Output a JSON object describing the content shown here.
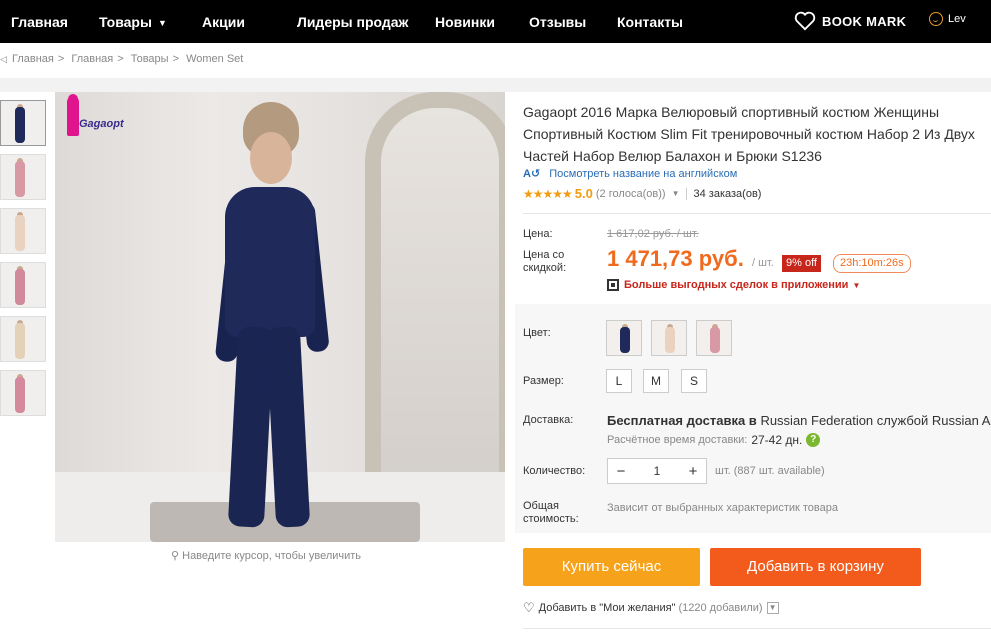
{
  "nav": {
    "items": [
      "Главная",
      "Товары",
      "Акции",
      "Лидеры продаж",
      "Новинки",
      "Отзывы",
      "Контакты"
    ],
    "bookmark": "BOOK MARK",
    "user": "Lev"
  },
  "breadcrumb": [
    "Главная",
    "Главная",
    "Товары",
    "Women Set"
  ],
  "product": {
    "title_lines": [
      "Gagaopt 2016 Марка Велюровый спортивный костюм Женщины",
      "Спортивный Костюм Slim Fit тренировочный костюм Набор 2 Из Двух",
      "Частей Набор Велюр Балахон и Брюки S1236"
    ],
    "translate_link": "Посмотреть название на английском",
    "rating": "5.0",
    "votes": "(2 голоса(ов))",
    "orders": "34 заказа(ов)",
    "brand_logo": "Gagaopt",
    "zoom_hint": "Наведите курсор, чтобы увеличить"
  },
  "price": {
    "label_price": "Цена:",
    "old": "1 617,02 руб. / шт.",
    "label_discount": "Цена со скидкой:",
    "current": "1 471,73 руб.",
    "unit": "/ шт.",
    "off": "9% off",
    "timer": "23h:10m:26s",
    "app_deals": "Больше выгодных сделок в приложении"
  },
  "options": {
    "color_label": "Цвет:",
    "size_label": "Размер:",
    "sizes": [
      "L",
      "M",
      "S"
    ],
    "shipping_label": "Доставка:",
    "shipping_free": "Бесплатная доставка в",
    "shipping_rest": "Russian Federation службой Russian Air Mail",
    "shipping_est_label": "Расчётное время доставки:",
    "shipping_days": "27-42 дн.",
    "qty_label": "Количество:",
    "qty_value": "1",
    "stock": "шт. (887 шт. available)",
    "total_label": "Общая стоимость:",
    "total_value": "Зависит от выбранных характеристик товара"
  },
  "actions": {
    "buy_now": "Купить сейчас",
    "add_to_cart": "Добавить в корзину",
    "wishlist": "Добавить в \"Мои желания\"",
    "wishlist_count": "(1220 добавили)"
  },
  "colors": {
    "accent_orange": "#f06a1d",
    "buy_button": "#f7a21b",
    "cart_button": "#f25b1c",
    "nav_bg": "#000000",
    "badge_red": "#c7261b",
    "stars": "#f39c12"
  },
  "icons": [
    "heart-icon",
    "user-icon",
    "home-icon",
    "search-icon",
    "translate-icon",
    "star-icon",
    "qr-icon",
    "help-icon",
    "chevron-down-icon"
  ]
}
